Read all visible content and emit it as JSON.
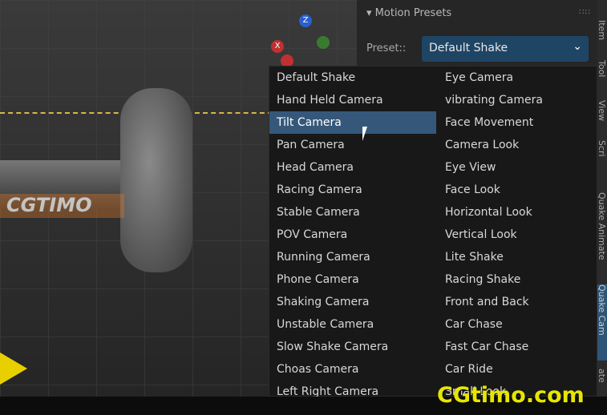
{
  "viewport": {
    "watermark": "CGTIMO",
    "gizmo": {
      "z": "Z",
      "x": "X",
      "y": "Y"
    }
  },
  "panel": {
    "title": "Motion Presets",
    "preset_label": "Preset::",
    "preset_value": "Default Shake",
    "accent": "#1f4565"
  },
  "side_tabs": [
    {
      "label": "Item"
    },
    {
      "label": "Tool"
    },
    {
      "label": "View"
    },
    {
      "label": "Scri"
    },
    {
      "label": "Quake Animate"
    },
    {
      "label": "Quake Cam",
      "active": true
    },
    {
      "label": "ate"
    }
  ],
  "menu": {
    "left": [
      "Default Shake",
      "Hand Held Camera",
      "Tilt Camera",
      "Pan Camera",
      "Head Camera",
      "Racing Camera",
      "Stable Camera",
      "POV Camera",
      "Running Camera",
      "Phone Camera",
      "Shaking Camera",
      "Unstable Camera",
      "Slow Shake Camera",
      "Choas Camera",
      "Left Right Camera"
    ],
    "right": [
      "Eye Camera",
      "vibrating Camera",
      "Face Movement",
      "Camera Look",
      "Eye View",
      "Face Look",
      "Horizontal Look",
      "Vertical Look",
      "Lite Shake",
      "Racing Shake",
      "Front and Back",
      "Car Chase",
      "Fast Car Chase",
      "Car Ride",
      "Small Look"
    ],
    "highlighted": "Tilt Camera"
  },
  "brand_watermark": "CGtimo.com"
}
